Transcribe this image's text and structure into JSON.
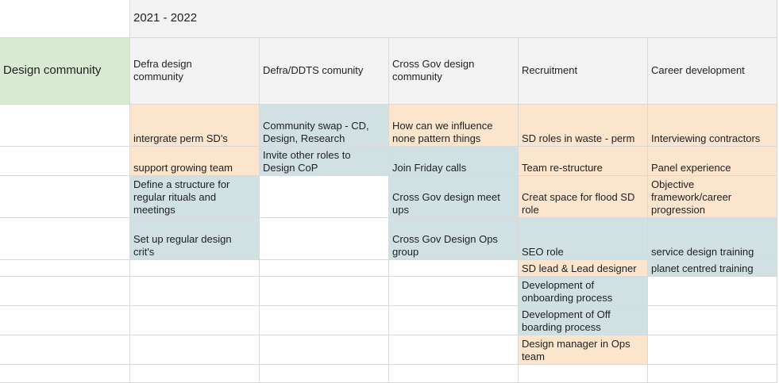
{
  "sheet": {
    "year_label": "2021 - 2022",
    "row_label": "Design community",
    "headers": [
      "Defra design\ncommunity",
      "Defra/DDTS comunity",
      "Cross Gov design\ncommunity",
      "Recruitment",
      "Career development"
    ],
    "columns": [
      {
        "items": [
          {
            "text": "intergrate perm SD's",
            "color": "orange"
          },
          {
            "text": "support growing team",
            "color": "orange"
          },
          {
            "text": "Define a structure for\nregular rituals and\nmeetings",
            "color": "blue"
          },
          {
            "text": "Set up regular design\ncrit's",
            "color": "blue"
          }
        ]
      },
      {
        "items": [
          {
            "text": "Community swap - CD,\nDesign, Research",
            "color": "blue"
          },
          {
            "text": "Invite other roles to\nDesign CoP",
            "color": "blue"
          }
        ]
      },
      {
        "items": [
          {
            "text": "How can we influence\nnone pattern things",
            "color": "orange"
          },
          {
            "text": "Join Friday calls",
            "color": "blue"
          },
          {
            "text": "Cross Gov design meet\nups",
            "color": "blue"
          },
          {
            "text": "Cross Gov Design Ops\ngroup",
            "color": "blue"
          }
        ]
      },
      {
        "items": [
          {
            "text": "SD roles in waste - perm",
            "color": "orange"
          },
          {
            "text": "Team re-structure",
            "color": "orange"
          },
          {
            "text": "Creat space for flood SD\nrole",
            "color": "orange"
          },
          {
            "text": "SEO role",
            "color": "blue"
          },
          {
            "text": "SD lead & Lead designer",
            "color": "orange"
          },
          {
            "text": "Development of\nonboarding process",
            "color": "blue"
          },
          {
            "text": "Development of Off\nboarding process",
            "color": "blue"
          },
          {
            "text": "Design manager in Ops\nteam",
            "color": "orange"
          }
        ]
      },
      {
        "items": [
          {
            "text": "Interviewing contractors",
            "color": "orange"
          },
          {
            "text": "Panel experience",
            "color": "orange"
          },
          {
            "text": "Objective\nframework/career\nprogression",
            "color": "orange"
          },
          {
            "text": "service design training",
            "color": "blue"
          },
          {
            "text": "planet centred training",
            "color": "blue"
          }
        ]
      }
    ]
  },
  "colors": {
    "orange": "#fce5cd",
    "blue": "#d0e0e3",
    "green": "#d9ead3",
    "header": "#f3f3f3",
    "gridline": "#d9d9d9"
  }
}
